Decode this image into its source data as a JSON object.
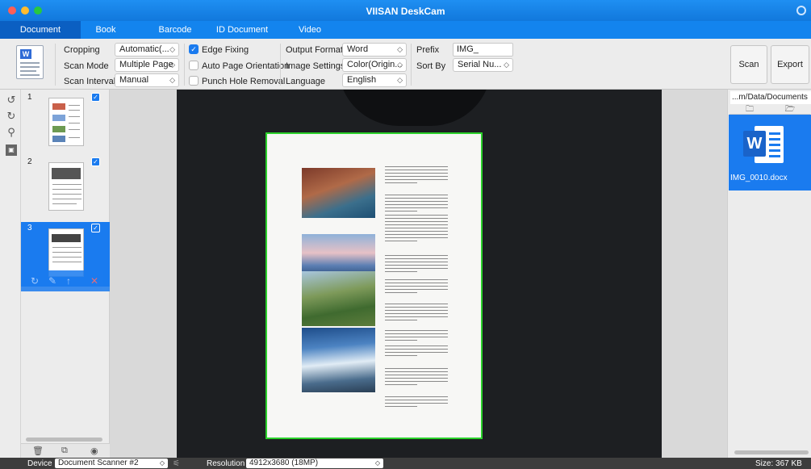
{
  "window": {
    "title": "VIISAN DeskCam"
  },
  "tabs": [
    {
      "label": "Document",
      "active": true
    },
    {
      "label": "Book",
      "active": false
    },
    {
      "label": "Barcode",
      "active": false
    },
    {
      "label": "ID Document",
      "active": false
    },
    {
      "label": "Video",
      "active": false
    }
  ],
  "toolbar": {
    "cropping_label": "Cropping",
    "cropping_value": "Automatic(...",
    "scan_mode_label": "Scan Mode",
    "scan_mode_value": "Multiple Page",
    "scan_interval_label": "Scan Interval",
    "scan_interval_value": "Manual",
    "edge_fixing_label": "Edge Fixing",
    "edge_fixing_checked": true,
    "auto_orientation_label": "Auto Page Orientation",
    "auto_orientation_checked": false,
    "punch_hole_label": "Punch Hole Removal",
    "punch_hole_checked": false,
    "output_format_label": "Output Format",
    "output_format_value": "Word",
    "image_settings_label": "Image Settings",
    "image_settings_value": "Color(Origin...",
    "language_label": "Language",
    "language_value": "English",
    "prefix_label": "Prefix",
    "prefix_value": "IMG_",
    "sort_by_label": "Sort By",
    "sort_by_value": "Serial Nu...",
    "scan_label": "Scan",
    "export_label": "Export"
  },
  "thumbnails": [
    {
      "number": "1",
      "checked": true,
      "selected": false
    },
    {
      "number": "2",
      "checked": true,
      "selected": false
    },
    {
      "number": "3",
      "checked": true,
      "selected": true
    }
  ],
  "right_panel": {
    "path": "...m/Data/Documents",
    "files": [
      {
        "name": "IMG_0010.docx",
        "type": "word-icon"
      }
    ]
  },
  "statusbar": {
    "device_label": "Device",
    "device_value": "Document Scanner #2",
    "resolution_label": "Resolution",
    "resolution_value": "4912x3680 (18MP)",
    "size_text": "Size: 367 KB"
  },
  "colors": {
    "accent": "#1a7bef",
    "titlebar": "#1384ee",
    "crop_border": "#2bd12b"
  }
}
